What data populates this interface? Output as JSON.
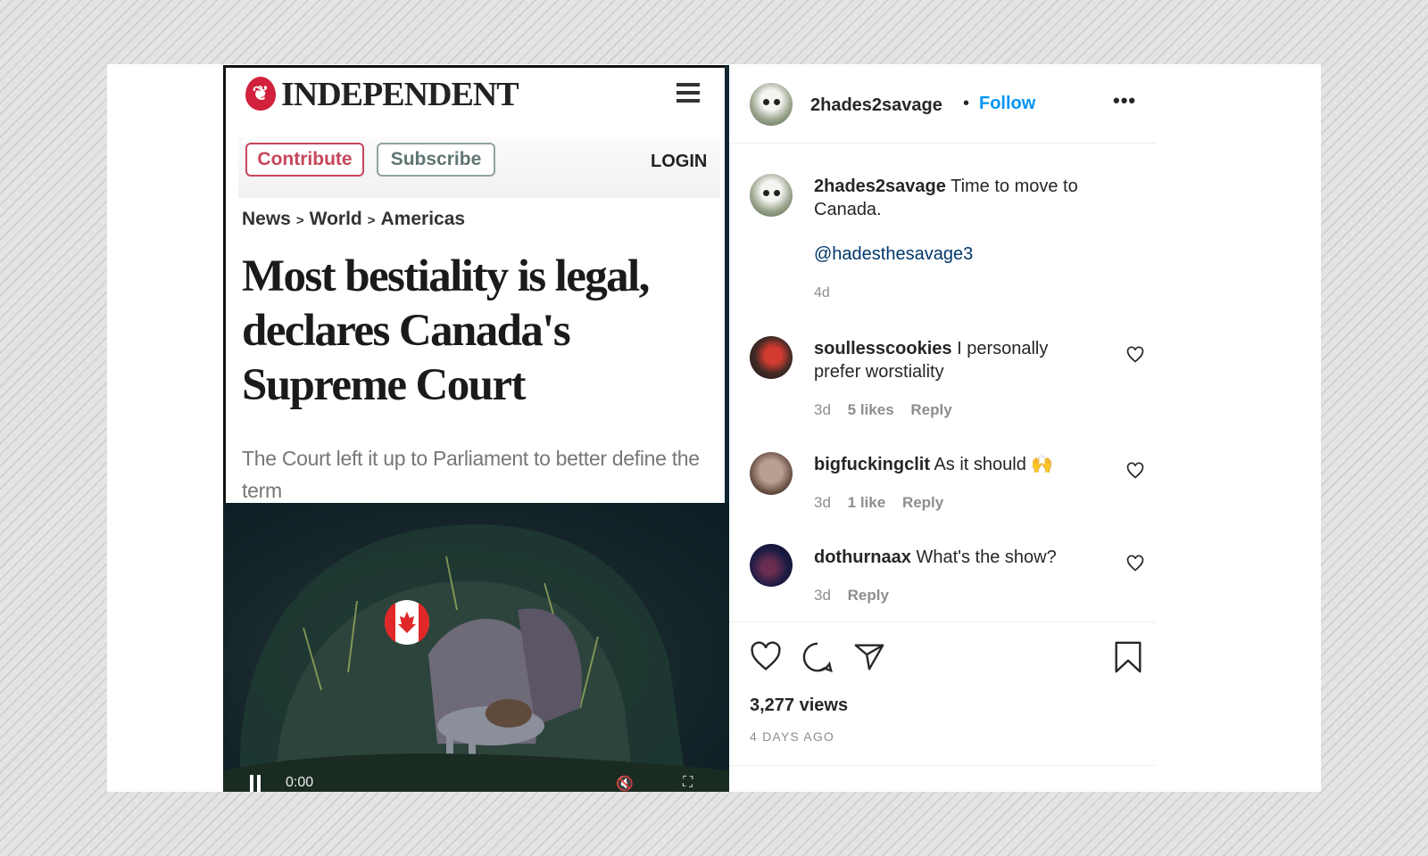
{
  "article": {
    "logo_text": "INDEPENDENT",
    "contribute_label": "Contribute",
    "subscribe_label": "Subscribe",
    "login_label": "LOGIN",
    "breadcrumb": [
      "News",
      "World",
      "Americas"
    ],
    "breadcrumb_separator": ">",
    "headline": "Most bestiality is legal, declares Canada's Supreme Court",
    "standfirst": "The Court left it up to Parliament to better define the term"
  },
  "video": {
    "time": "0:00"
  },
  "post": {
    "username": "2hades2savage",
    "separator": "•",
    "follow_label": "Follow",
    "more_icon": "more-options-icon",
    "caption": {
      "username": "2hades2savage",
      "text": "Time to move to Canada.",
      "mention": "@hadesthesavage3",
      "age": "4d"
    },
    "comments": [
      {
        "username": "soullesscookies",
        "text": "I personally prefer worstiality",
        "age": "3d",
        "likes": "5 likes",
        "reply": "Reply"
      },
      {
        "username": "bigfuckingclit",
        "text": "As it should",
        "emoji": "🙌",
        "age": "3d",
        "likes": "1 like",
        "reply": "Reply"
      },
      {
        "username": "dothurnaax",
        "text": "What's the show?",
        "age": "3d",
        "reply": "Reply"
      }
    ],
    "views": "3,277 views",
    "posted": "4 DAYS AGO"
  },
  "colors": {
    "follow_blue": "#0095f6",
    "mention_blue": "#00376b",
    "independent_red": "#d1213d",
    "muted_gray": "#8e8e8e"
  },
  "icons": [
    "like-icon",
    "comment-icon",
    "share-icon",
    "save-icon",
    "heart-icon",
    "menu-icon",
    "pause-icon",
    "mute-icon",
    "fullscreen-icon"
  ]
}
